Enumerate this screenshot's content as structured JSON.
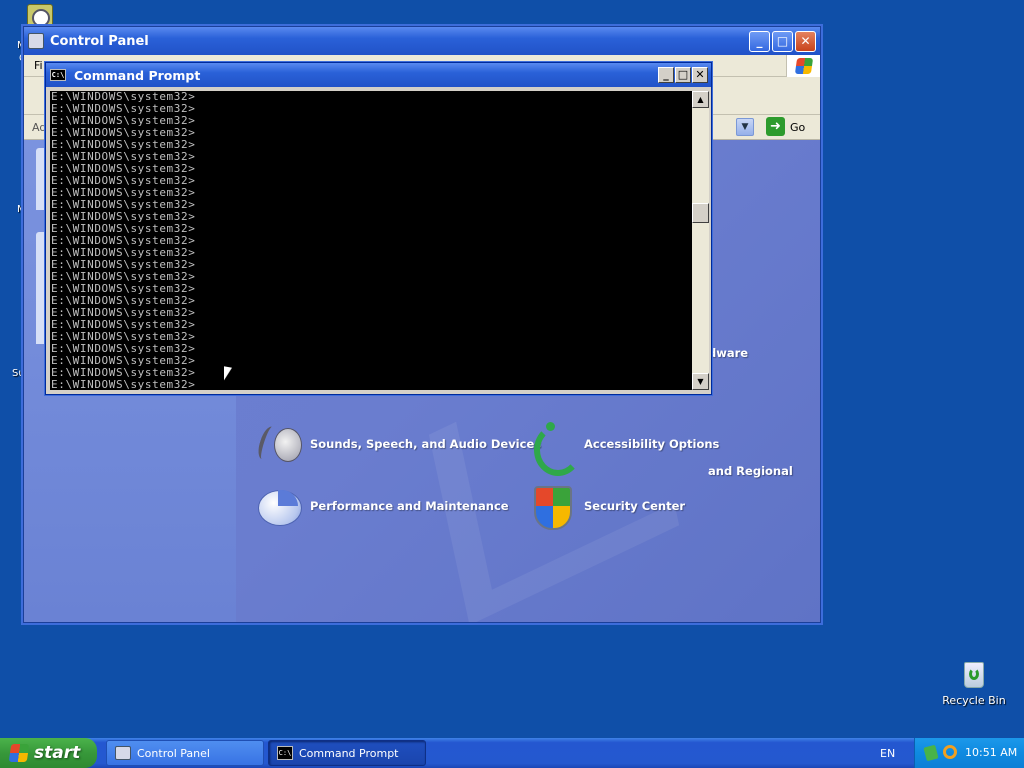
{
  "desktop": {
    "recycle_bin_label": "Recycle Bin",
    "clipped_labels": [
      "M",
      "C",
      "M",
      "Su"
    ]
  },
  "control_panel": {
    "title": "Control Panel",
    "menubar_clipped": "Fi",
    "address_label_clipped": "Ad",
    "go_label": "Go",
    "categories": {
      "hardware_clipped": "dware",
      "regional_clipped": "and Regional",
      "sounds": "Sounds, Speech, and Audio Devices",
      "accessibility": "Accessibility Options",
      "performance": "Performance and Maintenance",
      "security": "Security Center"
    }
  },
  "cmd": {
    "title": "Command Prompt",
    "icon_text": "C:\\",
    "lines": [
      "E:\\WINDOWS\\system32>",
      "E:\\WINDOWS\\system32>",
      "E:\\WINDOWS\\system32>",
      "E:\\WINDOWS\\system32>",
      "E:\\WINDOWS\\system32>",
      "E:\\WINDOWS\\system32>",
      "E:\\WINDOWS\\system32>",
      "E:\\WINDOWS\\system32>",
      "E:\\WINDOWS\\system32>",
      "E:\\WINDOWS\\system32>",
      "E:\\WINDOWS\\system32>",
      "E:\\WINDOWS\\system32>",
      "E:\\WINDOWS\\system32>",
      "E:\\WINDOWS\\system32>",
      "E:\\WINDOWS\\system32>",
      "E:\\WINDOWS\\system32>",
      "E:\\WINDOWS\\system32>",
      "E:\\WINDOWS\\system32>",
      "E:\\WINDOWS\\system32>",
      "E:\\WINDOWS\\system32>",
      "E:\\WINDOWS\\system32>",
      "E:\\WINDOWS\\system32>",
      "E:\\WINDOWS\\system32>",
      "E:\\WINDOWS\\system32>",
      "E:\\WINDOWS\\system32>"
    ]
  },
  "taskbar": {
    "start_label": "start",
    "items": [
      "Control Panel",
      "Command Prompt"
    ],
    "language": "EN",
    "clock": "10:51 AM"
  },
  "icons": {
    "title_minimize": "minimize-icon",
    "title_maximize": "maximize-icon",
    "title_close": "close-icon"
  },
  "colors": {
    "desktop": "#0f4fa8",
    "titlebar": "#2a61d8",
    "start_button": "#37983a"
  }
}
